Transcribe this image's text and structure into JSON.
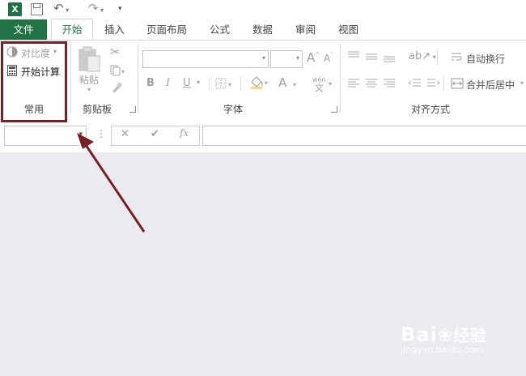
{
  "titlebar": {
    "app_icon": "excel-icon",
    "app_letter": "X",
    "qat": [
      "save-icon",
      "undo-icon",
      "redo-icon",
      "customize-qat-icon"
    ]
  },
  "tabs": {
    "file": "文件",
    "items": [
      {
        "label": "开始",
        "active": true
      },
      {
        "label": "插入"
      },
      {
        "label": "页面布局"
      },
      {
        "label": "公式"
      },
      {
        "label": "数据"
      },
      {
        "label": "审阅"
      },
      {
        "label": "视图"
      }
    ]
  },
  "ribbon": {
    "common_group": {
      "contrast_label": "对比度",
      "start_calc_label": "开始计算",
      "group_label": "常用"
    },
    "clipboard_group": {
      "paste_label": "粘贴",
      "group_label": "剪贴板"
    },
    "font_group": {
      "bold": "B",
      "italic": "I",
      "underline": "U",
      "grow_font": "A",
      "shrink_font": "A",
      "font_color": "A",
      "phonetic_top": "wén",
      "phonetic_bottom": "文",
      "group_label": "字体"
    },
    "alignment_group": {
      "wrap_text_label": "自动换行",
      "merge_center_label": "合并后居中",
      "group_label": "对齐方式"
    }
  },
  "formula_bar": {
    "cancel": "✕",
    "enter": "✔",
    "fx": "fx",
    "more": "⋮"
  },
  "watermark": {
    "brand": "Bai",
    "brand_suffix": "经验",
    "url": "jingyan.baidu.com"
  },
  "colors": {
    "excel_green": "#217346",
    "highlight": "#7c1f24",
    "arrow": "#7c1f24",
    "workspace": "#e9ebef"
  }
}
